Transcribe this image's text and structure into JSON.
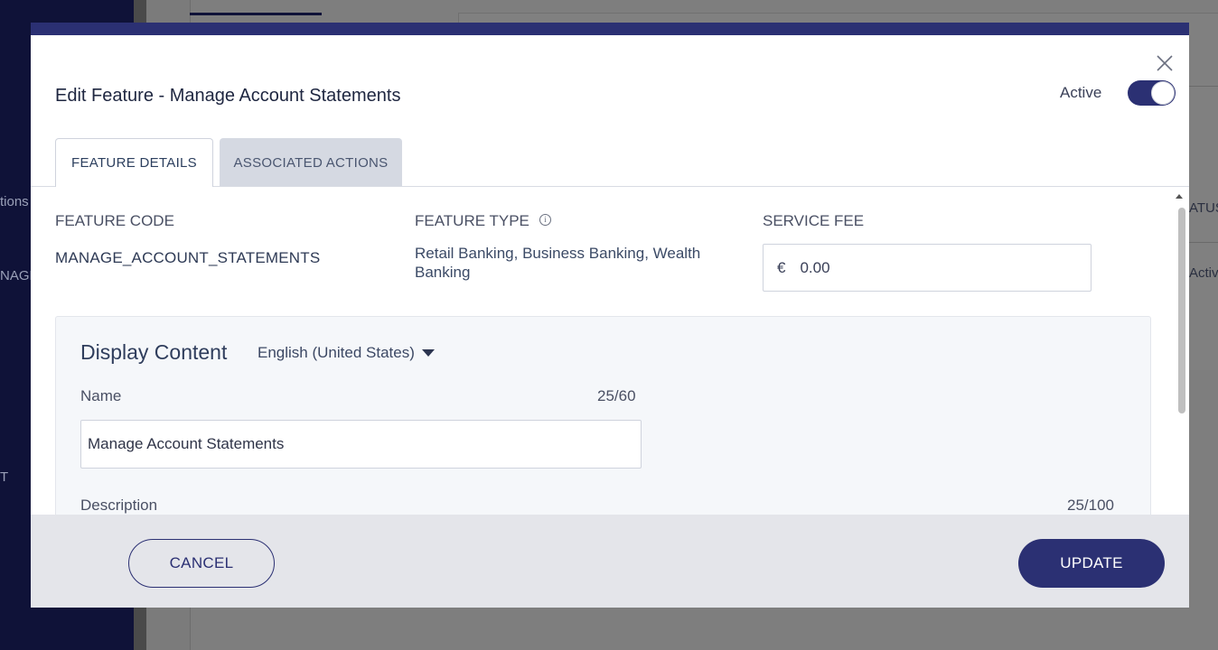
{
  "background": {
    "sidebar_items": [
      "tions",
      "NAGE",
      "T"
    ],
    "table_header": "ATUS",
    "table_cell": "Activ"
  },
  "modal": {
    "title_prefix": "Edit Feature -",
    "title_name": "Manage Account Statements",
    "active_label": "Active",
    "active_state": true,
    "close_icon": "close-icon",
    "tabs": [
      {
        "label": "FEATURE DETAILS",
        "selected": true
      },
      {
        "label": "ASSOCIATED ACTIONS",
        "selected": false
      }
    ],
    "fields": {
      "feature_code_label": "FEATURE CODE",
      "feature_code_value": "MANAGE_ACCOUNT_STATEMENTS",
      "feature_type_label": "FEATURE TYPE",
      "feature_type_value": "Retail Banking, Business Banking, Wealth Banking",
      "service_fee_label": "SERVICE FEE",
      "service_fee_currency": "€",
      "service_fee_value": "0.00"
    },
    "display_content": {
      "title": "Display Content",
      "language": "English (United States)",
      "name_label": "Name",
      "name_count": "25/60",
      "name_value": "Manage Account Statements",
      "description_label": "Description",
      "description_count": "25/100"
    },
    "footer": {
      "cancel_label": "CANCEL",
      "update_label": "UPDATE"
    }
  },
  "colors": {
    "primary": "#2b3073",
    "sidebar": "#0f1238",
    "panel_bg": "#f5f7fa",
    "footer_bg": "#e4e5ea"
  }
}
